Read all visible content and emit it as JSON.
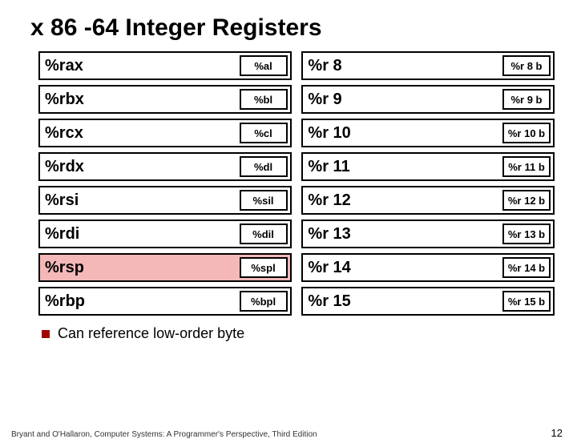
{
  "title": "x 86 -64 Integer Registers",
  "rows": [
    {
      "left_big": "%rax",
      "left_small": "%al",
      "left_pink": false,
      "right_big": "%r 8",
      "right_small": "%r 8 b"
    },
    {
      "left_big": "%rbx",
      "left_small": "%bl",
      "left_pink": false,
      "right_big": "%r 9",
      "right_small": "%r 9 b"
    },
    {
      "left_big": "%rcx",
      "left_small": "%cl",
      "left_pink": false,
      "right_big": "%r 10",
      "right_small": "%r 10 b"
    },
    {
      "left_big": "%rdx",
      "left_small": "%dl",
      "left_pink": false,
      "right_big": "%r 11",
      "right_small": "%r 11 b"
    },
    {
      "left_big": "%rsi",
      "left_small": "%sil",
      "left_pink": false,
      "right_big": "%r 12",
      "right_small": "%r 12 b"
    },
    {
      "left_big": "%rdi",
      "left_small": "%dil",
      "left_pink": false,
      "right_big": "%r 13",
      "right_small": "%r 13 b"
    },
    {
      "left_big": "%rsp",
      "left_small": "%spl",
      "left_pink": true,
      "right_big": "%r 14",
      "right_small": "%r 14 b"
    },
    {
      "left_big": "%rbp",
      "left_small": "%bpl",
      "left_pink": false,
      "right_big": "%r 15",
      "right_small": "%r 15 b"
    }
  ],
  "bullet": "Can reference low-order byte",
  "footer_left": "Bryant and O'Hallaron, Computer Systems: A Programmer's Perspective, Third Edition",
  "page_number": "12"
}
